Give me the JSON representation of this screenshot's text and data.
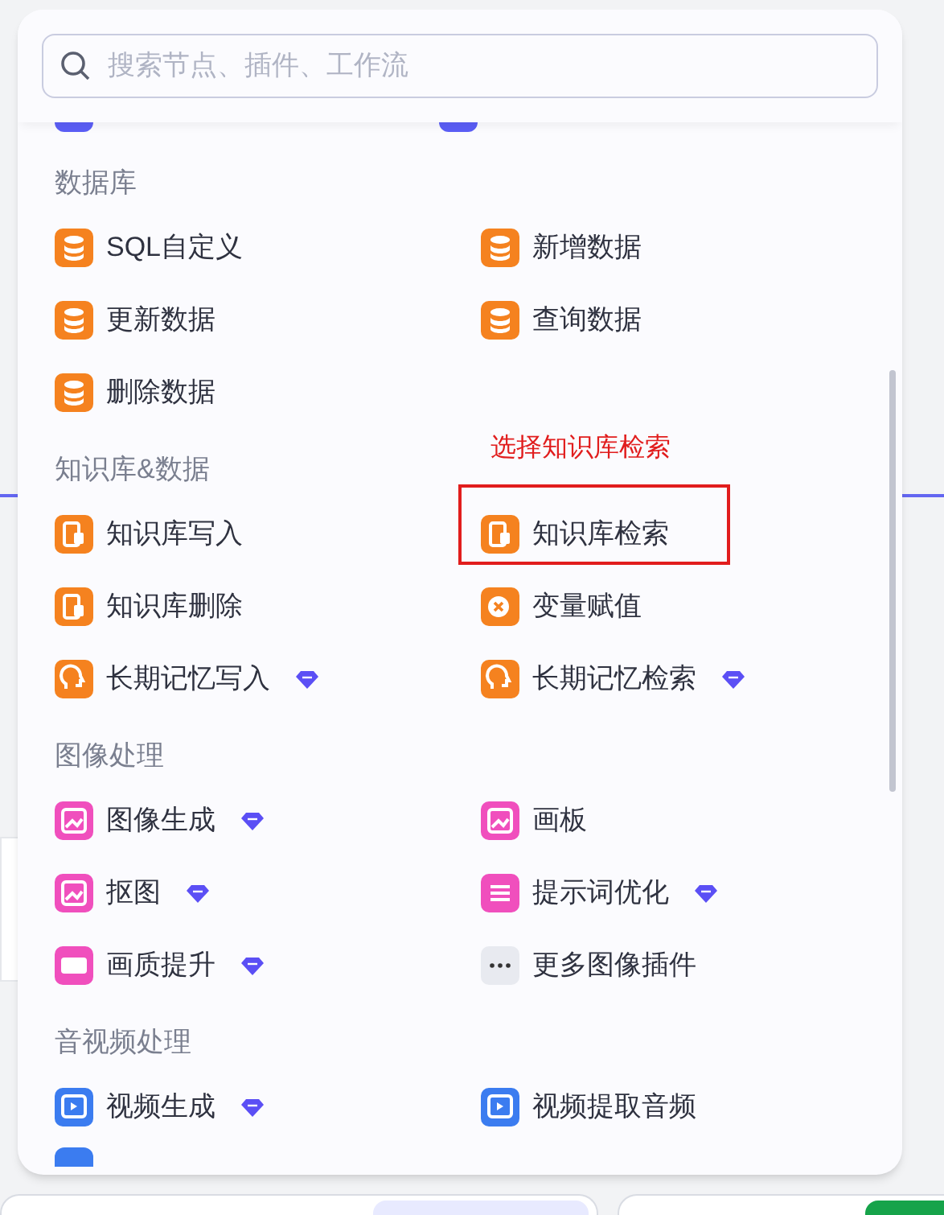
{
  "search": {
    "placeholder": "搜索节点、插件、工作流"
  },
  "sections": [
    {
      "title": "数据库",
      "items": [
        {
          "label": "SQL自定义",
          "kind": "database",
          "color": "#f5821f",
          "premium": false,
          "highlighted": false
        },
        {
          "label": "新增数据",
          "kind": "database",
          "color": "#f5821f",
          "premium": false,
          "highlighted": false
        },
        {
          "label": "更新数据",
          "kind": "database",
          "color": "#f5821f",
          "premium": false,
          "highlighted": false
        },
        {
          "label": "查询数据",
          "kind": "database",
          "color": "#f5821f",
          "premium": false,
          "highlighted": false
        },
        {
          "label": "删除数据",
          "kind": "database",
          "color": "#f5821f",
          "premium": false,
          "highlighted": false
        }
      ]
    },
    {
      "title": "知识库&数据",
      "items": [
        {
          "label": "知识库写入",
          "kind": "knowledge",
          "color": "#f5821f",
          "premium": false,
          "highlighted": false
        },
        {
          "label": "知识库检索",
          "kind": "knowledge",
          "color": "#f5821f",
          "premium": false,
          "highlighted": true
        },
        {
          "label": "知识库删除",
          "kind": "knowledge",
          "color": "#f5821f",
          "premium": false,
          "highlighted": false
        },
        {
          "label": "变量赋值",
          "kind": "variable",
          "color": "#f5821f",
          "premium": false,
          "highlighted": false
        },
        {
          "label": "长期记忆写入",
          "kind": "memory",
          "color": "#f5821f",
          "premium": true,
          "highlighted": false
        },
        {
          "label": "长期记忆检索",
          "kind": "memory",
          "color": "#f5821f",
          "premium": true,
          "highlighted": false
        }
      ]
    },
    {
      "title": "图像处理",
      "items": [
        {
          "label": "图像生成",
          "kind": "image",
          "color": "#f04fbd",
          "premium": true,
          "highlighted": false
        },
        {
          "label": "画板",
          "kind": "image",
          "color": "#f04fbd",
          "premium": false,
          "highlighted": false
        },
        {
          "label": "抠图",
          "kind": "image",
          "color": "#f04fbd",
          "premium": true,
          "highlighted": false
        },
        {
          "label": "提示词优化",
          "kind": "sliders",
          "color": "#f04fbd",
          "premium": true,
          "highlighted": false
        },
        {
          "label": "画质提升",
          "kind": "hd",
          "color": "#f04fbd",
          "premium": true,
          "highlighted": false
        },
        {
          "label": "更多图像插件",
          "kind": "more",
          "color": "#e8eaf0",
          "premium": false,
          "highlighted": false
        }
      ]
    },
    {
      "title": "音视频处理",
      "items": [
        {
          "label": "视频生成",
          "kind": "video",
          "color": "#3b7cf0",
          "premium": true,
          "highlighted": false
        },
        {
          "label": "视频提取音频",
          "kind": "video",
          "color": "#3b7cf0",
          "premium": false,
          "highlighted": false
        }
      ]
    }
  ],
  "annotation": {
    "text": "选择知识库检索"
  }
}
